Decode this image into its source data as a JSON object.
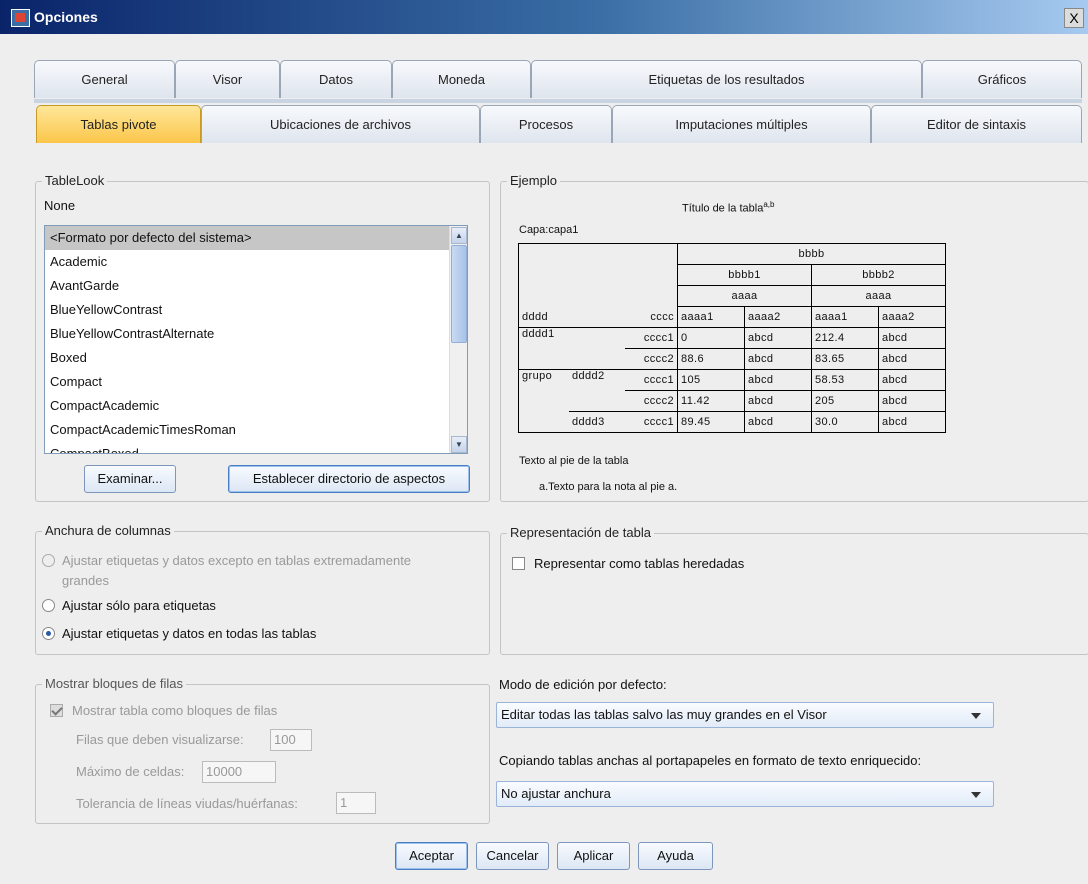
{
  "window": {
    "title": "Opciones",
    "close": "X"
  },
  "tabs_row1": [
    "General",
    "Visor",
    "Datos",
    "Moneda",
    "Etiquetas de los resultados",
    "Gráficos"
  ],
  "tabs_row2": [
    "Tablas pivote",
    "Ubicaciones de archivos",
    "Procesos",
    "Imputaciones múltiples",
    "Editor de sintaxis"
  ],
  "tablelook": {
    "legend": "TableLook",
    "current": "None",
    "items": [
      "<Formato por defecto del sistema>",
      "Academic",
      "AvantGarde",
      "BlueYellowContrast",
      "BlueYellowContrastAlternate",
      "Boxed",
      "Compact",
      "CompactAcademic",
      "CompactAcademicTimesRoman",
      "CompactBoxed"
    ],
    "selected_index": 0,
    "browse": "Examinar...",
    "set_dir": "Establecer directorio de aspectos"
  },
  "example": {
    "legend": "Ejemplo",
    "title": "Título de la tabla",
    "title_sup": "a,b",
    "layer": "Capa:capa1",
    "h_top": "bbbb",
    "h_b1": "bbbb1",
    "h_b2": "bbbb2",
    "h_a1": "aaaa",
    "h_a2": "aaaa",
    "col_labels": [
      "aaaa1",
      "aaaa2",
      "aaaa1",
      "aaaa2"
    ],
    "row_head_dddd": "dddd",
    "row_head_cccc": "cccc",
    "grupo": "grupo",
    "rows": [
      {
        "g": "dddd1",
        "d": "",
        "c": "cccc1",
        "v": [
          "0",
          "abcd",
          "212.4",
          "abcd"
        ]
      },
      {
        "g": "",
        "d": "",
        "c": "cccc2",
        "v": [
          "88.6",
          "abcd",
          "83.65",
          "abcd"
        ]
      },
      {
        "g": "",
        "d": "dddd2",
        "c": "cccc1",
        "v": [
          "105",
          "abcd",
          "58.53",
          "abcd"
        ]
      },
      {
        "g": "",
        "d": "",
        "c": "cccc2",
        "v": [
          "11.42",
          "abcd",
          "205",
          "abcd"
        ]
      },
      {
        "g": "",
        "d": "dddd3",
        "c": "cccc1",
        "v": [
          "89.45",
          "abcd",
          "30.0",
          "abcd"
        ]
      }
    ],
    "footer": "Texto al pie de la tabla",
    "footnote": "a.Texto para la nota al pie a."
  },
  "col_width": {
    "legend": "Anchura de columnas",
    "options": [
      {
        "label": "Ajustar etiquetas y datos excepto en tablas extremadamente",
        "label2": "grandes",
        "checked": false,
        "disabled": true
      },
      {
        "label": "Ajustar sólo para etiquetas",
        "checked": false,
        "disabled": false
      },
      {
        "label": "Ajustar etiquetas y datos en todas las tablas",
        "checked": true,
        "disabled": false
      }
    ]
  },
  "table_render": {
    "legend": "Representación de tabla",
    "checkbox": "Representar como tablas heredadas",
    "checked": false
  },
  "row_blocks": {
    "legend": "Mostrar bloques de filas",
    "checkbox": "Mostrar tabla como bloques de filas",
    "checked": true,
    "rows_label": "Filas que deben visualizarse:",
    "rows_value": "100",
    "cells_label": "Máximo de celdas:",
    "cells_value": "10000",
    "orphan_label": "Tolerancia de líneas viudas/huérfanas:",
    "orphan_value": "1"
  },
  "edit_mode": {
    "label": "Modo de edición por defecto:",
    "value": "Editar todas las tablas salvo las muy grandes en el Visor"
  },
  "copy_wide": {
    "label": "Copiando tablas anchas al portapapeles en formato de texto enriquecido:",
    "value": "No ajustar anchura"
  },
  "buttons": {
    "ok": "Aceptar",
    "cancel": "Cancelar",
    "apply": "Aplicar",
    "help": "Ayuda"
  }
}
